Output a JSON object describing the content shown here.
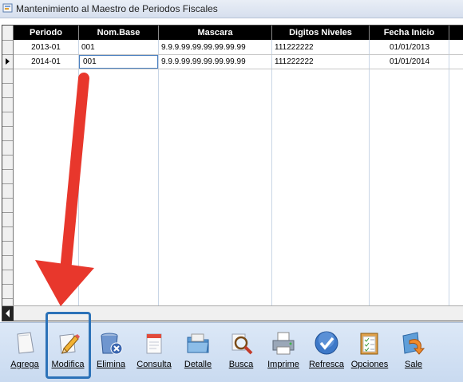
{
  "window": {
    "title": "Mantenimiento al Maestro de Periodos Fiscales"
  },
  "grid": {
    "columns": [
      "Periodo",
      "Nom.Base",
      "Mascara",
      "Digitos Niveles",
      "Fecha Inicio"
    ],
    "rows": [
      [
        "2013-01",
        "001",
        "9.9.9.99.99.99.99.99.99",
        "111222222",
        "01/01/2013"
      ],
      [
        "2014-01",
        "001",
        "9.9.9.99.99.99.99.99.99",
        "111222222",
        "01/01/2014"
      ]
    ]
  },
  "toolbar": {
    "buttons": [
      {
        "label": "Agrega",
        "icon": "paper-icon"
      },
      {
        "label": "Modifica",
        "icon": "pencil-edit-icon"
      },
      {
        "label": "Elimina",
        "icon": "trash-icon"
      },
      {
        "label": "Consulta",
        "icon": "document-query-icon"
      },
      {
        "label": "Detalle",
        "icon": "folder-icon"
      },
      {
        "label": "Busca",
        "icon": "magnifier-icon"
      },
      {
        "label": "Imprime",
        "icon": "printer-icon"
      },
      {
        "label": "Refresca",
        "icon": "checkmark-icon"
      },
      {
        "label": "Opciones",
        "icon": "clipboard-icon"
      },
      {
        "label": "Sale",
        "icon": "exit-arrow-icon"
      }
    ]
  },
  "colors": {
    "annotation_arrow": "#e8372c",
    "highlight": "#2c72b8"
  }
}
